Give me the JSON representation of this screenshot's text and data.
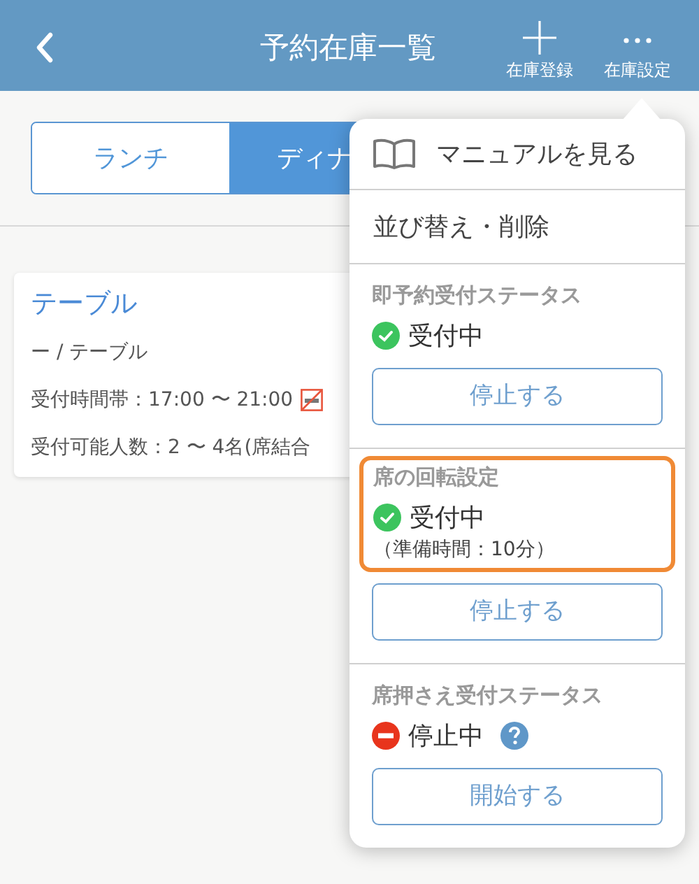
{
  "header": {
    "title": "予約在庫一覧",
    "actions": [
      {
        "kind": "plus",
        "label": "在庫登録"
      },
      {
        "kind": "more",
        "label": "在庫設定"
      }
    ]
  },
  "segments": [
    {
      "label": "ランチ",
      "selected": false
    },
    {
      "label": "ディナ",
      "selected": true
    }
  ],
  "card": {
    "title": "テーブル",
    "lines": [
      {
        "text": "ー / テーブル",
        "no_smoking": false
      },
      {
        "text": "受付時間帯：17:00 〜 21:00",
        "no_smoking": true
      },
      {
        "text": "受付可能人数：2 〜 4名(席結合",
        "no_smoking": false
      }
    ]
  },
  "menu": {
    "items": [
      {
        "kind": "manual",
        "label": "マニュアルを見る"
      },
      {
        "kind": "link",
        "label": "並び替え・削除"
      },
      {
        "kind": "status",
        "title": "即予約受付ステータス",
        "accepting": true,
        "status_label": "受付中",
        "highlighted": false,
        "help": false,
        "button": "停止する"
      },
      {
        "kind": "status",
        "title": "席の回転設定",
        "accepting": true,
        "status_label": "受付中",
        "note": "（準備時間：10分）",
        "highlighted": true,
        "help": false,
        "button": "停止する"
      },
      {
        "kind": "status",
        "title": "席押さえ受付ステータス",
        "accepting": false,
        "status_label": "停止中",
        "highlighted": false,
        "help": true,
        "button": "開始する"
      }
    ]
  }
}
